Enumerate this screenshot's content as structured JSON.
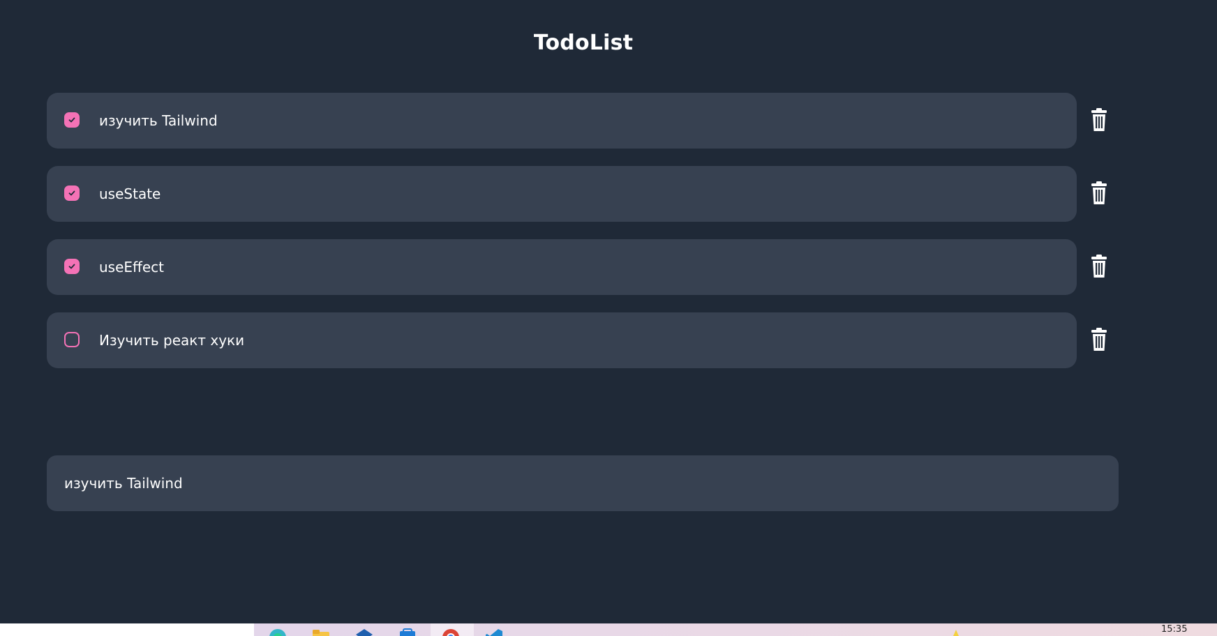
{
  "app": {
    "title": "TodoList"
  },
  "todos": [
    {
      "text": "изучить Tailwind",
      "completed": true,
      "delete_icon": "trash-icon"
    },
    {
      "text": "useState",
      "completed": true,
      "delete_icon": "trash-icon"
    },
    {
      "text": "useEffect",
      "completed": true,
      "delete_icon": "trash-icon"
    },
    {
      "text": "Изучить реакт хуки",
      "completed": false,
      "delete_icon": "trash-icon"
    }
  ],
  "input": {
    "value": "изучить Tailwind"
  },
  "colors": {
    "background": "#1f2937",
    "card": "#374151",
    "accent": "#f472b6",
    "text": "#ffffff"
  },
  "taskbar": {
    "clock": "15:35",
    "icons": [
      "edge-icon",
      "folder-icon",
      "app-icon",
      "store-icon",
      "chrome-icon",
      "vscode-icon",
      "notification-icon"
    ]
  }
}
